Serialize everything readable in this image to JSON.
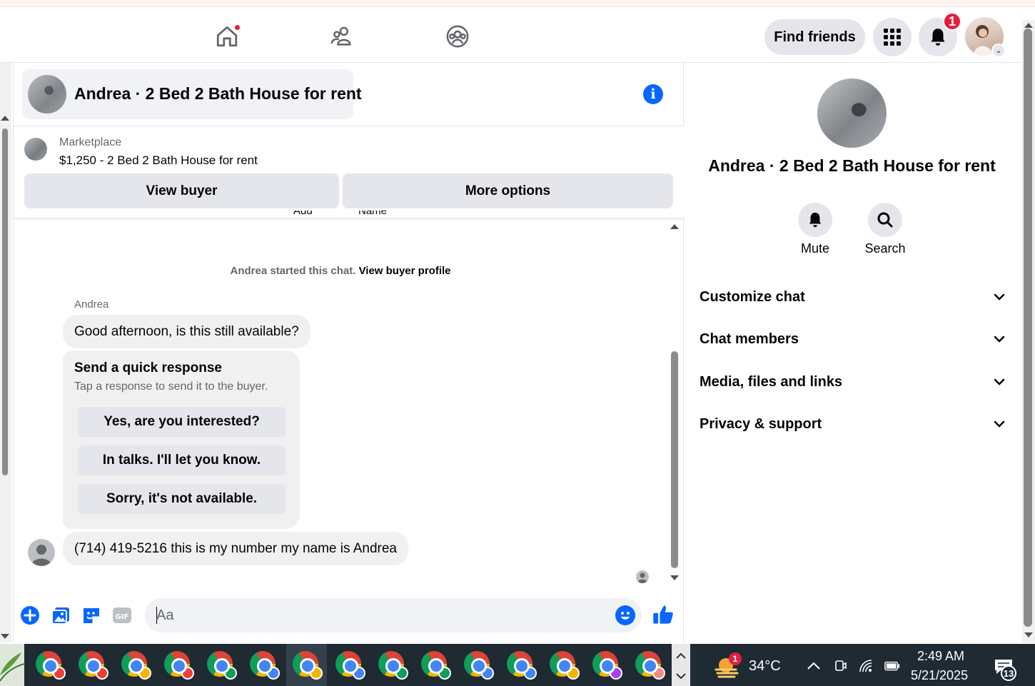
{
  "header": {
    "find_friends_label": "Find friends",
    "notification_count": "1"
  },
  "chat": {
    "title": "Andrea · 2 Bed 2 Bath House for rent",
    "marketplace": {
      "label": "Marketplace",
      "listing": "$1,250 - 2 Bed 2 Bath House for rent",
      "view_buyer_label": "View buyer",
      "more_options_label": "More options"
    },
    "clipped_labels": [
      "Add",
      "Name"
    ],
    "started_text": "Andrea started this chat.",
    "view_profile_link": "View buyer profile",
    "sender_name": "Andrea",
    "messages": [
      "Good afternoon, is this still available?",
      "(714) 419-5216 this is my number my name is Andrea"
    ],
    "quick_response": {
      "title": "Send a quick response",
      "subtitle": "Tap a response to send it to the buyer.",
      "options": [
        "Yes, are you interested?",
        "In talks. I'll let you know.",
        "Sorry, it's not available."
      ]
    },
    "composer_placeholder": "Aa"
  },
  "details": {
    "title": "Andrea · 2 Bed 2 Bath House for rent",
    "actions": [
      "Mute",
      "Search"
    ],
    "sections": [
      "Customize chat",
      "Chat members",
      "Media, files and links",
      "Privacy & support"
    ]
  },
  "taskbar": {
    "weather_badge": "1",
    "temperature": "34°C",
    "time": "2:49 AM",
    "date": "5/21/2025",
    "notification_count": "13",
    "chrome_profile_colors": [
      "#e94235",
      "#e94235",
      "#f4b400",
      "#e94235",
      "#0f9d58",
      "#4285f4",
      "#f4b400",
      "#4285f4",
      "#0f9d58",
      "#0f9d58",
      "#4285f4",
      "#4285f4",
      "#f4b400",
      "#a142f4",
      "#f28b82"
    ]
  },
  "colors": {
    "accent": "#0866ff",
    "badge": "#e41e3f",
    "bubble": "#f0f0f0",
    "button": "#e4e6eb"
  }
}
